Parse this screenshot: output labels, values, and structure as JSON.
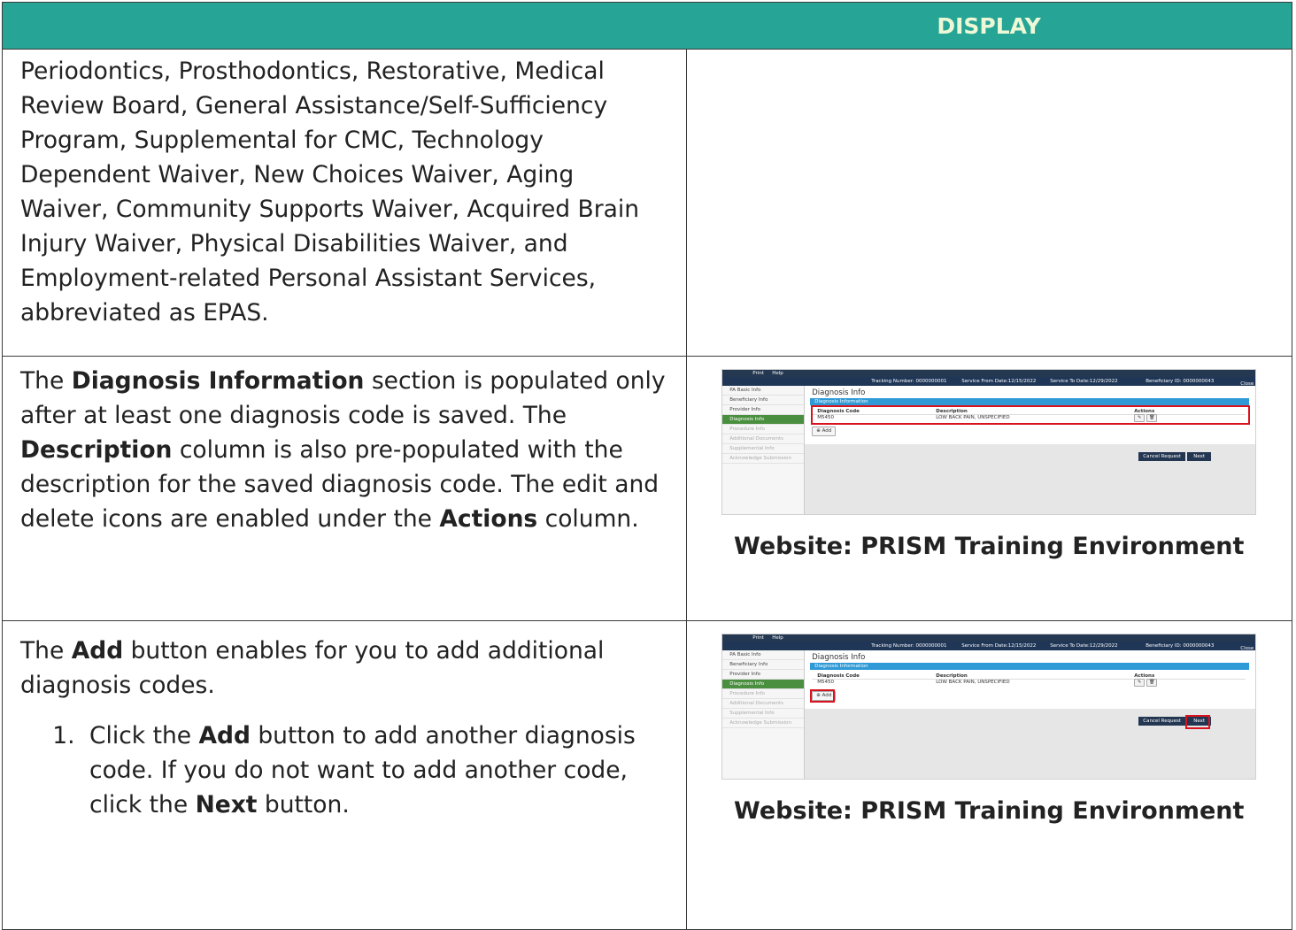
{
  "header": {
    "display_label": "DISPLAY"
  },
  "row1": {
    "text": "Periodontics, Prosthodontics, Restorative, Medical Review Board, General Assistance/Self-Sufficiency Program, Supplemental for CMC, Technology Dependent Waiver, New Choices Waiver, Aging Waiver, Community Supports Waiver, Acquired Brain Injury Waiver, Physical Disabilities Waiver, and Employment-related Personal Assistant Services, abbreviated as EPAS."
  },
  "row2": {
    "t1": "The ",
    "b1": "Diagnosis Information",
    "t2": " section is populated only after at least one diagnosis code is saved. The ",
    "b2": "Description",
    "t3": " column is also pre-populated with the description for the saved diagnosis code. The edit and delete icons are enabled under the ",
    "b3": "Actions",
    "t4": " column.",
    "caption": "Website: PRISM Training Environment"
  },
  "row3": {
    "t1": "The ",
    "b1": "Add",
    "t2": " button enables for you to add additional diagnosis codes.",
    "step_t1": "Click the ",
    "step_b1": "Add",
    "step_t2": " button to add another diagnosis code. If you do not want to add another code, click the ",
    "step_b2": "Next",
    "step_t3": " button.",
    "caption": "Website: PRISM Training Environment"
  },
  "screenshot": {
    "print": "Print",
    "help": "Help",
    "tracking": "Tracking Number: 0000000001",
    "service_from": "Service From Date:12/15/2022",
    "service_to": "Service To Date:12/29/2022",
    "beneficiary": "Beneficiary ID: 0000000043",
    "close": "Close",
    "nav": [
      "PA Basic Info",
      "Beneficiary Info",
      "Provider Info",
      "Diagnosis Info",
      "Procedure Info",
      "Additional Documents",
      "Supplemental Info",
      "Acknowledge Submission"
    ],
    "page_title": "Diagnosis Info",
    "section_header": "Diagnosis Information",
    "col_code": "Diagnosis Code",
    "col_desc": "Description",
    "col_actions": "Actions",
    "code": "M5450",
    "description": "LOW BACK PAIN, UNSPECIFIED",
    "add": "Add",
    "cancel": "Cancel Request",
    "next": "Next"
  }
}
